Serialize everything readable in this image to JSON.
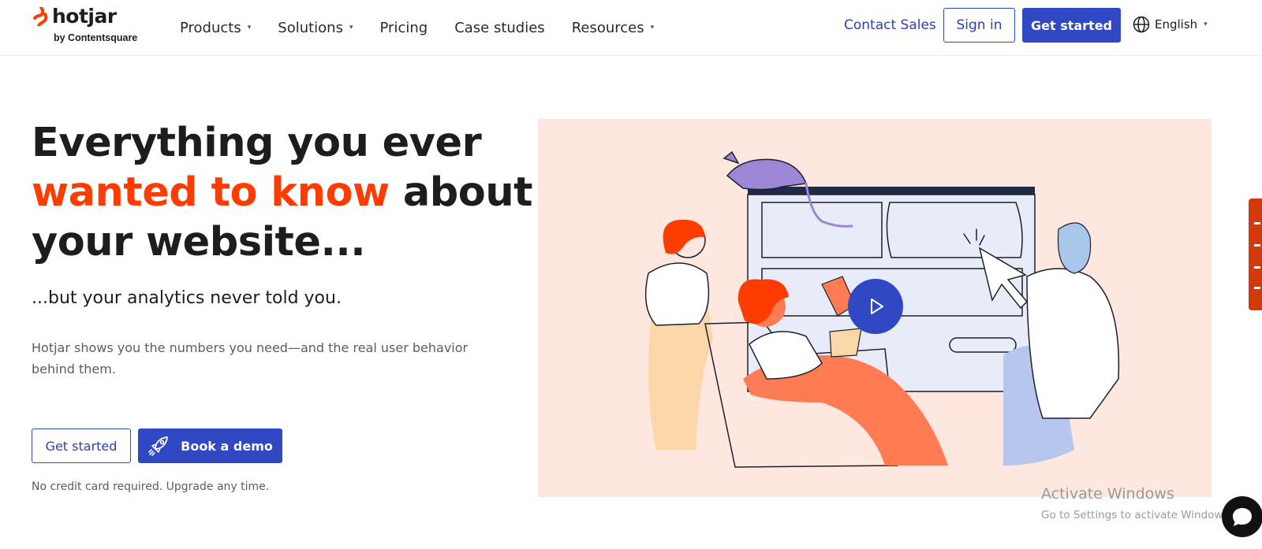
{
  "brand": {
    "name": "hotjar",
    "tagline": "by Contentsquare",
    "accent": "#ff3c00",
    "primary": "#3148c4"
  },
  "nav": {
    "items": [
      {
        "label": "Products",
        "dropdown": true
      },
      {
        "label": "Solutions",
        "dropdown": true
      },
      {
        "label": "Pricing",
        "dropdown": false
      },
      {
        "label": "Case studies",
        "dropdown": false
      },
      {
        "label": "Resources",
        "dropdown": true
      }
    ],
    "contact": "Contact Sales",
    "signin": "Sign in",
    "get_started": "Get started",
    "language": "English"
  },
  "hero": {
    "headline_line1": "Everything you ever",
    "headline_accent": "wanted to know",
    "headline_rest1": " about",
    "headline_line3": "your website...",
    "subhead": "...but your analytics never told you.",
    "description": "Hotjar shows you the numbers you need—and the real user behavior behind them.",
    "cta_primary": "Get started",
    "cta_demo": "Book a demo",
    "note": "No credit card required. Upgrade any time."
  },
  "watermark": {
    "title": "Activate Windows",
    "subtitle": "Go to Settings to activate Windows."
  },
  "icons": [
    "hotjar-logo-icon",
    "chevron-down-icon",
    "globe-icon",
    "rocket-icon",
    "play-icon",
    "chat-icon"
  ]
}
